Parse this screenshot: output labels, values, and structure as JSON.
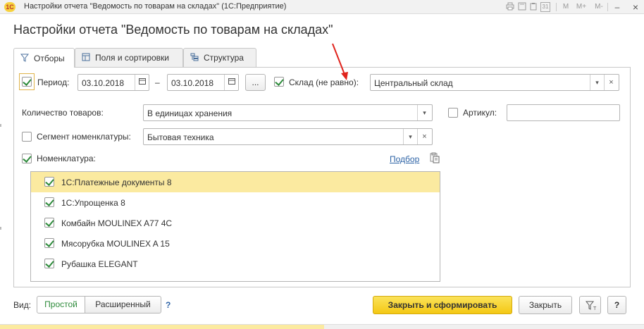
{
  "window": {
    "title": "Настройки отчета \"Ведомость по товарам на складах\"  (1С:Предприятие)",
    "logo": "1С",
    "toolbar_icons": [
      "printer-icon",
      "save-icon",
      "clipboard-icon",
      "calendar-icon"
    ],
    "calendar_text": "31",
    "memory_buttons": [
      "M",
      "M+",
      "M-"
    ],
    "minimize": "–",
    "maximize": "☐",
    "close": "×"
  },
  "form_title": "Настройки отчета \"Ведомость по товарам на складах\"",
  "tabs": [
    {
      "label": "Отборы",
      "icon": "filter-icon",
      "active": true
    },
    {
      "label": "Поля и сортировки",
      "icon": "table-icon",
      "active": false
    },
    {
      "label": "Структура",
      "icon": "structure-icon",
      "active": false
    }
  ],
  "filters": {
    "period": {
      "label": "Период:",
      "checked": true,
      "from": "03.10.2018",
      "dash": "–",
      "to": "03.10.2018",
      "more": "..."
    },
    "warehouse": {
      "label": "Склад (не равно):",
      "checked": true,
      "value": "Центральный склад"
    },
    "quantity": {
      "label": "Количество товаров:",
      "value": "В единицах хранения"
    },
    "article": {
      "label": "Артикул:",
      "checked": false,
      "value": ""
    },
    "segment": {
      "label": "Сегмент номенклатуры:",
      "checked": false,
      "value": "Бытовая техника"
    },
    "nomenclature": {
      "label": "Номенклатура:",
      "checked": true,
      "pick_link": "Подбор"
    }
  },
  "nomenclature_items": [
    {
      "label": "1С:Платежные документы 8",
      "checked": true,
      "selected": true
    },
    {
      "label": "1С:Упрощенка 8",
      "checked": true,
      "selected": false
    },
    {
      "label": "Комбайн MOULINEX  A77 4C",
      "checked": true,
      "selected": false
    },
    {
      "label": "Мясорубка MOULINEX  A 15",
      "checked": true,
      "selected": false
    },
    {
      "label": "Рубашка ELEGANT",
      "checked": true,
      "selected": false
    }
  ],
  "footer": {
    "view_label": "Вид:",
    "view_simple": "Простой",
    "view_extended": "Расширенный",
    "help_mark": "?",
    "generate_button": "Закрыть и сформировать",
    "close_button": "Закрыть",
    "help_button": "?"
  },
  "colors": {
    "accent_green": "#2e8b3b",
    "primary_button": "#f4c814",
    "selected_row": "#fbeaa0",
    "link": "#2d63a6",
    "annotation_arrow": "#e0231c"
  }
}
